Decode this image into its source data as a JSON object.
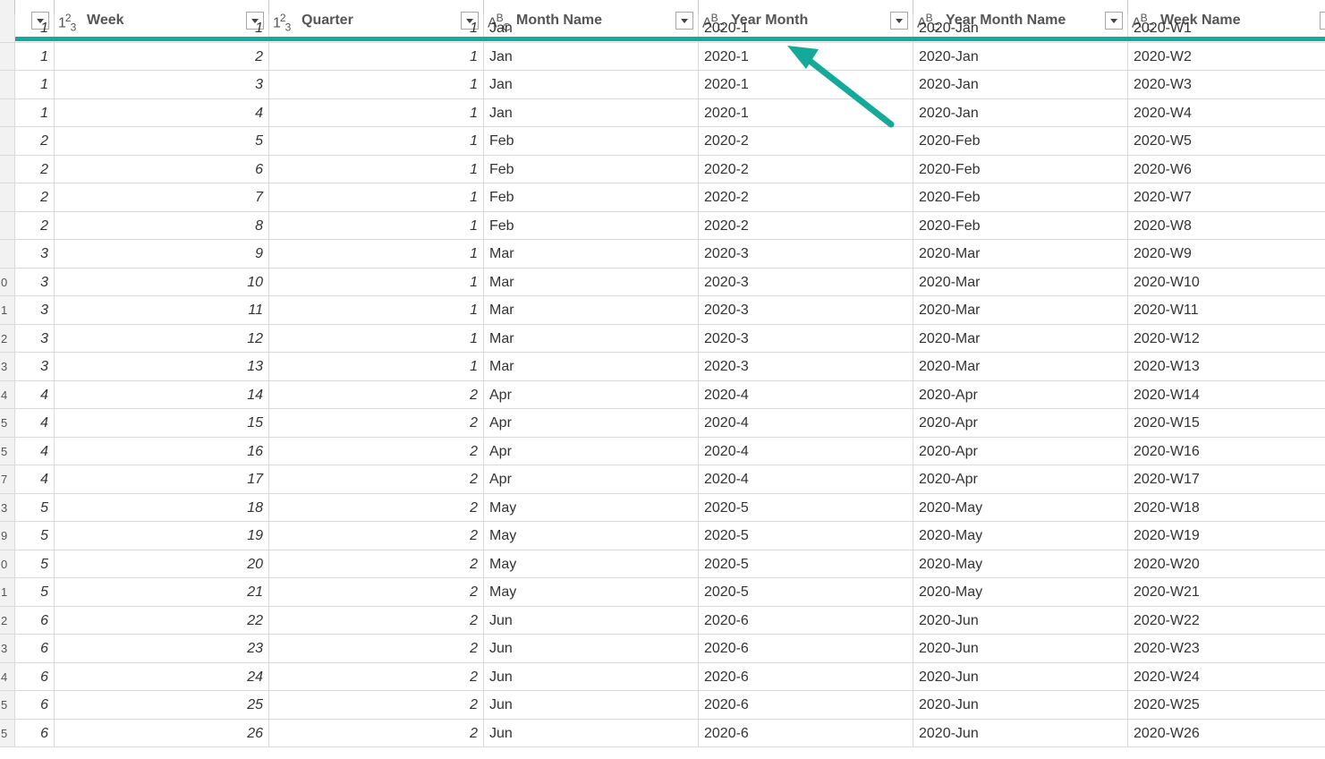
{
  "header": {
    "index_label": "1.",
    "columns": [
      {
        "type_icon": "",
        "label": ""
      },
      {
        "type_icon": "123",
        "label": "Week"
      },
      {
        "type_icon": "123",
        "label": "Quarter"
      },
      {
        "type_icon": "ABC",
        "label": "Month Name"
      },
      {
        "type_icon": "ABC",
        "label": "Year Month"
      },
      {
        "type_icon": "ABC",
        "label": "Year Month Name"
      },
      {
        "type_icon": "ABC",
        "label": "Week Name"
      }
    ]
  },
  "rows": [
    {
      "idx": "",
      "c0": "1",
      "c1": "1",
      "c2": "1",
      "c3": "Jan",
      "c4": "2020-1",
      "c5": "2020-Jan",
      "c6": "2020-W1"
    },
    {
      "idx": "",
      "c0": "1",
      "c1": "2",
      "c2": "1",
      "c3": "Jan",
      "c4": "2020-1",
      "c5": "2020-Jan",
      "c6": "2020-W2"
    },
    {
      "idx": "",
      "c0": "1",
      "c1": "3",
      "c2": "1",
      "c3": "Jan",
      "c4": "2020-1",
      "c5": "2020-Jan",
      "c6": "2020-W3"
    },
    {
      "idx": "",
      "c0": "1",
      "c1": "4",
      "c2": "1",
      "c3": "Jan",
      "c4": "2020-1",
      "c5": "2020-Jan",
      "c6": "2020-W4"
    },
    {
      "idx": "",
      "c0": "2",
      "c1": "5",
      "c2": "1",
      "c3": "Feb",
      "c4": "2020-2",
      "c5": "2020-Feb",
      "c6": "2020-W5"
    },
    {
      "idx": "",
      "c0": "2",
      "c1": "6",
      "c2": "1",
      "c3": "Feb",
      "c4": "2020-2",
      "c5": "2020-Feb",
      "c6": "2020-W6"
    },
    {
      "idx": "",
      "c0": "2",
      "c1": "7",
      "c2": "1",
      "c3": "Feb",
      "c4": "2020-2",
      "c5": "2020-Feb",
      "c6": "2020-W7"
    },
    {
      "idx": "",
      "c0": "2",
      "c1": "8",
      "c2": "1",
      "c3": "Feb",
      "c4": "2020-2",
      "c5": "2020-Feb",
      "c6": "2020-W8"
    },
    {
      "idx": "",
      "c0": "3",
      "c1": "9",
      "c2": "1",
      "c3": "Mar",
      "c4": "2020-3",
      "c5": "2020-Mar",
      "c6": "2020-W9"
    },
    {
      "idx": "0",
      "c0": "3",
      "c1": "10",
      "c2": "1",
      "c3": "Mar",
      "c4": "2020-3",
      "c5": "2020-Mar",
      "c6": "2020-W10"
    },
    {
      "idx": "1",
      "c0": "3",
      "c1": "11",
      "c2": "1",
      "c3": "Mar",
      "c4": "2020-3",
      "c5": "2020-Mar",
      "c6": "2020-W11"
    },
    {
      "idx": "2",
      "c0": "3",
      "c1": "12",
      "c2": "1",
      "c3": "Mar",
      "c4": "2020-3",
      "c5": "2020-Mar",
      "c6": "2020-W12"
    },
    {
      "idx": "3",
      "c0": "3",
      "c1": "13",
      "c2": "1",
      "c3": "Mar",
      "c4": "2020-3",
      "c5": "2020-Mar",
      "c6": "2020-W13"
    },
    {
      "idx": "4",
      "c0": "4",
      "c1": "14",
      "c2": "2",
      "c3": "Apr",
      "c4": "2020-4",
      "c5": "2020-Apr",
      "c6": "2020-W14"
    },
    {
      "idx": "5",
      "c0": "4",
      "c1": "15",
      "c2": "2",
      "c3": "Apr",
      "c4": "2020-4",
      "c5": "2020-Apr",
      "c6": "2020-W15"
    },
    {
      "idx": "5",
      "c0": "4",
      "c1": "16",
      "c2": "2",
      "c3": "Apr",
      "c4": "2020-4",
      "c5": "2020-Apr",
      "c6": "2020-W16"
    },
    {
      "idx": "7",
      "c0": "4",
      "c1": "17",
      "c2": "2",
      "c3": "Apr",
      "c4": "2020-4",
      "c5": "2020-Apr",
      "c6": "2020-W17"
    },
    {
      "idx": "3",
      "c0": "5",
      "c1": "18",
      "c2": "2",
      "c3": "May",
      "c4": "2020-5",
      "c5": "2020-May",
      "c6": "2020-W18"
    },
    {
      "idx": "9",
      "c0": "5",
      "c1": "19",
      "c2": "2",
      "c3": "May",
      "c4": "2020-5",
      "c5": "2020-May",
      "c6": "2020-W19"
    },
    {
      "idx": "0",
      "c0": "5",
      "c1": "20",
      "c2": "2",
      "c3": "May",
      "c4": "2020-5",
      "c5": "2020-May",
      "c6": "2020-W20"
    },
    {
      "idx": "1",
      "c0": "5",
      "c1": "21",
      "c2": "2",
      "c3": "May",
      "c4": "2020-5",
      "c5": "2020-May",
      "c6": "2020-W21"
    },
    {
      "idx": "2",
      "c0": "6",
      "c1": "22",
      "c2": "2",
      "c3": "Jun",
      "c4": "2020-6",
      "c5": "2020-Jun",
      "c6": "2020-W22"
    },
    {
      "idx": "3",
      "c0": "6",
      "c1": "23",
      "c2": "2",
      "c3": "Jun",
      "c4": "2020-6",
      "c5": "2020-Jun",
      "c6": "2020-W23"
    },
    {
      "idx": "4",
      "c0": "6",
      "c1": "24",
      "c2": "2",
      "c3": "Jun",
      "c4": "2020-6",
      "c5": "2020-Jun",
      "c6": "2020-W24"
    },
    {
      "idx": "5",
      "c0": "6",
      "c1": "25",
      "c2": "2",
      "c3": "Jun",
      "c4": "2020-6",
      "c5": "2020-Jun",
      "c6": "2020-W25"
    },
    {
      "idx": "5",
      "c0": "6",
      "c1": "26",
      "c2": "2",
      "c3": "Jun",
      "c4": "2020-6",
      "c5": "2020-Jun",
      "c6": "2020-W26"
    }
  ],
  "colors": {
    "accent": "#15a99a",
    "arrow": "#15a99a"
  }
}
